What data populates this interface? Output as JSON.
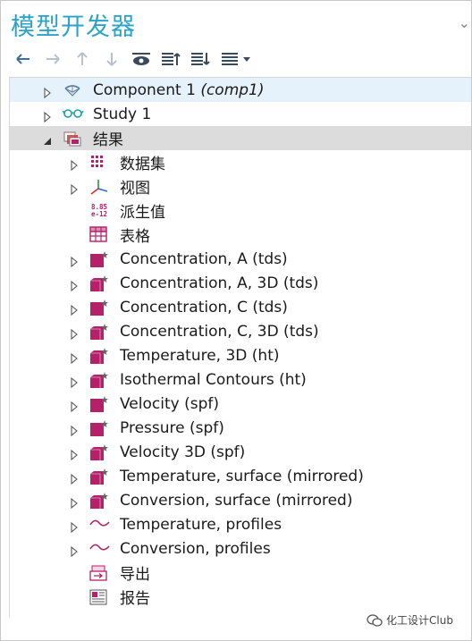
{
  "window": {
    "title": "模型开发器"
  },
  "toolbar": {
    "buttons": [
      {
        "name": "back-arrow-icon"
      },
      {
        "name": "forward-arrow-icon"
      },
      {
        "name": "up-arrow-icon"
      },
      {
        "name": "down-arrow-icon"
      },
      {
        "name": "show-icon"
      },
      {
        "name": "collapse-all-icon"
      },
      {
        "name": "expand-all-icon"
      },
      {
        "name": "view-options-icon"
      }
    ]
  },
  "tree": {
    "items": [
      {
        "label": "Component 1",
        "tag": "(comp1)",
        "level": 0,
        "expand": "collapsed",
        "icon": "component-icon"
      },
      {
        "label": "Study 1",
        "level": 0,
        "expand": "collapsed",
        "icon": "study-icon"
      },
      {
        "label": "结果",
        "level": 0,
        "expand": "expanded",
        "icon": "results-icon"
      },
      {
        "label": "数据集",
        "level": 1,
        "expand": "collapsed",
        "icon": "datasets-icon"
      },
      {
        "label": "视图",
        "level": 1,
        "expand": "collapsed",
        "icon": "views-icon"
      },
      {
        "label": "派生值",
        "level": 1,
        "expand": "none",
        "icon": "derived-values-icon",
        "icon_text_top": "8.85",
        "icon_text_bottom": "e-12"
      },
      {
        "label": "表格",
        "level": 1,
        "expand": "none",
        "icon": "tables-icon"
      },
      {
        "label": "Concentration, A (tds)",
        "level": 1,
        "expand": "collapsed",
        "icon": "plot-group-2d-icon"
      },
      {
        "label": "Concentration, A, 3D (tds)",
        "level": 1,
        "expand": "collapsed",
        "icon": "plot-group-3d-icon"
      },
      {
        "label": "Concentration, C (tds)",
        "level": 1,
        "expand": "collapsed",
        "icon": "plot-group-2d-icon"
      },
      {
        "label": "Concentration, C, 3D (tds)",
        "level": 1,
        "expand": "collapsed",
        "icon": "plot-group-3d-icon"
      },
      {
        "label": "Temperature, 3D (ht)",
        "level": 1,
        "expand": "collapsed",
        "icon": "plot-group-3d-icon"
      },
      {
        "label": "Isothermal Contours (ht)",
        "level": 1,
        "expand": "collapsed",
        "icon": "plot-group-3d-icon"
      },
      {
        "label": "Velocity (spf)",
        "level": 1,
        "expand": "collapsed",
        "icon": "plot-group-2d-icon"
      },
      {
        "label": "Pressure (spf)",
        "level": 1,
        "expand": "collapsed",
        "icon": "plot-group-2d-icon"
      },
      {
        "label": "Velocity 3D (spf)",
        "level": 1,
        "expand": "collapsed",
        "icon": "plot-group-3d-icon"
      },
      {
        "label": "Temperature, surface (mirrored)",
        "level": 1,
        "expand": "collapsed",
        "icon": "plot-group-3d-icon"
      },
      {
        "label": "Conversion, surface (mirrored)",
        "level": 1,
        "expand": "collapsed",
        "icon": "plot-group-3d-icon"
      },
      {
        "label": "Temperature, profiles",
        "level": 1,
        "expand": "collapsed",
        "icon": "plot-group-1d-icon"
      },
      {
        "label": "Conversion, profiles",
        "level": 1,
        "expand": "collapsed",
        "icon": "plot-group-1d-icon"
      },
      {
        "label": "导出",
        "level": 1,
        "expand": "none",
        "icon": "export-icon"
      },
      {
        "label": "报告",
        "level": 1,
        "expand": "none",
        "icon": "reports-icon"
      }
    ]
  },
  "watermark": {
    "text": "化工设计Club"
  },
  "colors": {
    "accent": "#2aa3c9",
    "plot": "#b5206a",
    "selected": "#dcdcdc",
    "hover": "#e5f1fb"
  }
}
